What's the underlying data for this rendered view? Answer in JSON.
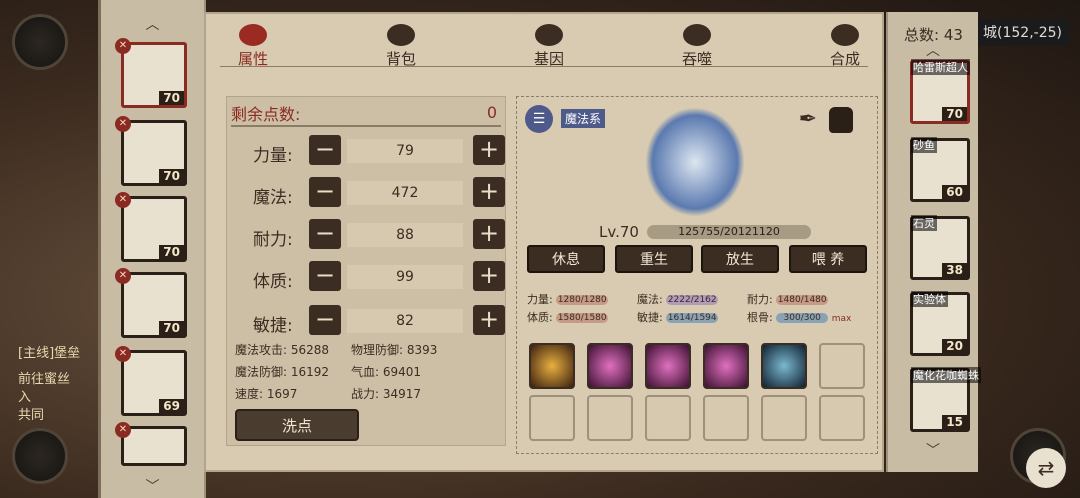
{
  "background": {
    "quest_lines": [
      "[主线]堡垒",
      "前往蜜丝",
      "入",
      "共同"
    ],
    "coord": "城(152,-25)"
  },
  "left_list": {
    "items": [
      {
        "level": "70",
        "badge": "✕"
      },
      {
        "level": "70",
        "badge": "✕"
      },
      {
        "level": "70",
        "badge": "✕"
      },
      {
        "level": "70",
        "badge": "✕"
      },
      {
        "level": "69",
        "badge": "✕"
      },
      {
        "level": "",
        "badge": "✕"
      }
    ]
  },
  "tabs": [
    {
      "label": "属性",
      "active": true
    },
    {
      "label": "背包"
    },
    {
      "label": "基因"
    },
    {
      "label": "吞噬"
    },
    {
      "label": "合成"
    }
  ],
  "stats": {
    "remaining_label": "剩余点数:",
    "remaining_value": "0",
    "rows": [
      {
        "label": "力量:",
        "value": "79"
      },
      {
        "label": "魔法:",
        "value": "472"
      },
      {
        "label": "耐力:",
        "value": "88"
      },
      {
        "label": "体质:",
        "value": "99"
      },
      {
        "label": "敏捷:",
        "value": "82"
      }
    ],
    "summary": [
      [
        "魔法攻击: 56288",
        "物理防御: 8393"
      ],
      [
        "魔法防御: 16192",
        "气血: 69401"
      ],
      [
        "速度: 1697",
        "战力: 34917"
      ]
    ],
    "wash_label": "洗点",
    "minus_glyph": "−",
    "plus_glyph": "+"
  },
  "pet": {
    "type_tag": "魔法系",
    "level": "Lv.70",
    "exp": "125755/20121120",
    "actions": [
      "休息",
      "重生",
      "放生",
      "喂 养"
    ],
    "attrs": [
      {
        "label": "力量:",
        "value": "1280/1280"
      },
      {
        "label": "魔法:",
        "value": "2222/2162"
      },
      {
        "label": "耐力:",
        "value": "1480/1480"
      },
      {
        "label": "体质:",
        "value": "1580/1580"
      },
      {
        "label": "敏捷:",
        "value": "1614/1594"
      },
      {
        "label": "根骨:",
        "value": "300/300"
      }
    ],
    "max_label": "max",
    "skill_count": 5,
    "colors": {
      "bar_red": "#c69a86",
      "bar_blue": "#8aa2b5",
      "bar_purple": "#b29ab8",
      "accent": "#8b2a22"
    }
  },
  "right_list": {
    "total": "总数: 43",
    "items": [
      {
        "name": "哈雷斯超人",
        "level": "70"
      },
      {
        "name": "砂鱼",
        "level": "60"
      },
      {
        "name": "石灵",
        "level": "38"
      },
      {
        "name": "实验体",
        "level": "20"
      },
      {
        "name": "魔化花咖蜘蛛",
        "level": "15"
      }
    ]
  }
}
